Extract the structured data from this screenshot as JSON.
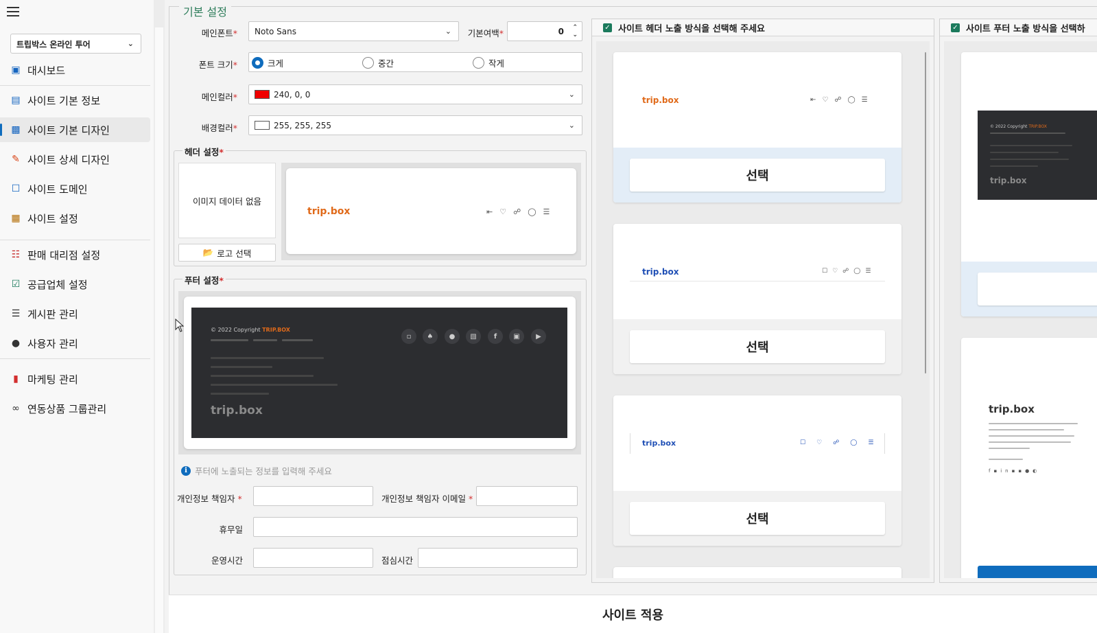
{
  "sidebar": {
    "company": "트립박스 온라인 투어",
    "items": [
      {
        "label": "대시보드"
      },
      {
        "label": "사이트 기본 정보"
      },
      {
        "label": "사이트 기본 디자인"
      },
      {
        "label": "사이트 상세 디자인"
      },
      {
        "label": "사이트 도메인"
      },
      {
        "label": "사이트 설정"
      },
      {
        "label": "판매 대리점 설정"
      },
      {
        "label": "공급업체 설정"
      },
      {
        "label": "게시판 관리"
      },
      {
        "label": "사용자 관리"
      },
      {
        "label": "마케팅 관리"
      },
      {
        "label": "연동상품 그룹관리"
      }
    ]
  },
  "basic": {
    "title": "기본 설정",
    "main_font_label": "메인폰트",
    "main_font_value": "Noto Sans",
    "margin_label": "기본여백",
    "margin_value": "0",
    "font_size_label": "폰트 크기",
    "size_large": "크게",
    "size_medium": "중간",
    "size_small": "작게",
    "main_color_label": "메인컬러",
    "main_color_value": "240, 0, 0",
    "main_color_hex": "#f00000",
    "bg_color_label": "배경컬러",
    "bg_color_value": "255, 255, 255",
    "bg_color_hex": "#ffffff",
    "required_mark": "*"
  },
  "header_settings": {
    "title": "헤더 설정",
    "no_image": "이미지 데이터 없음",
    "logo_button": "로고 선택",
    "brand": "trip.box"
  },
  "footer_settings": {
    "title": "푸터 설정",
    "copyright": "© 2022 Copyright",
    "copyright_brand": "TRIP.BOX",
    "brand": "trip.box",
    "info_msg": "푸터에 노출되는 정보를 입력해 주세요",
    "privacy_officer_label": "개인정보 책임자",
    "privacy_email_label": "개인정보 책임자 이메일",
    "holiday_label": "휴무일",
    "hours_label": "운영시간",
    "lunch_label": "점심시간"
  },
  "header_panel": {
    "title": "사이트 헤더 노출 방식을 선택해 주세요",
    "select_label": "선택",
    "brand": "trip.box"
  },
  "footer_panel": {
    "title": "사이트 푸터 노출 방식을 선택하",
    "copyright": "© 2022 Copyright",
    "copyright_brand": "TRIP.BOX",
    "brand": "trip.box"
  },
  "apply_button": "사이트 적용",
  "colors": {
    "accent": "#0f6cbd",
    "section_title": "#2e7d5b",
    "brand_orange": "#e06a1a",
    "brand_blue": "#1f4fb5"
  }
}
